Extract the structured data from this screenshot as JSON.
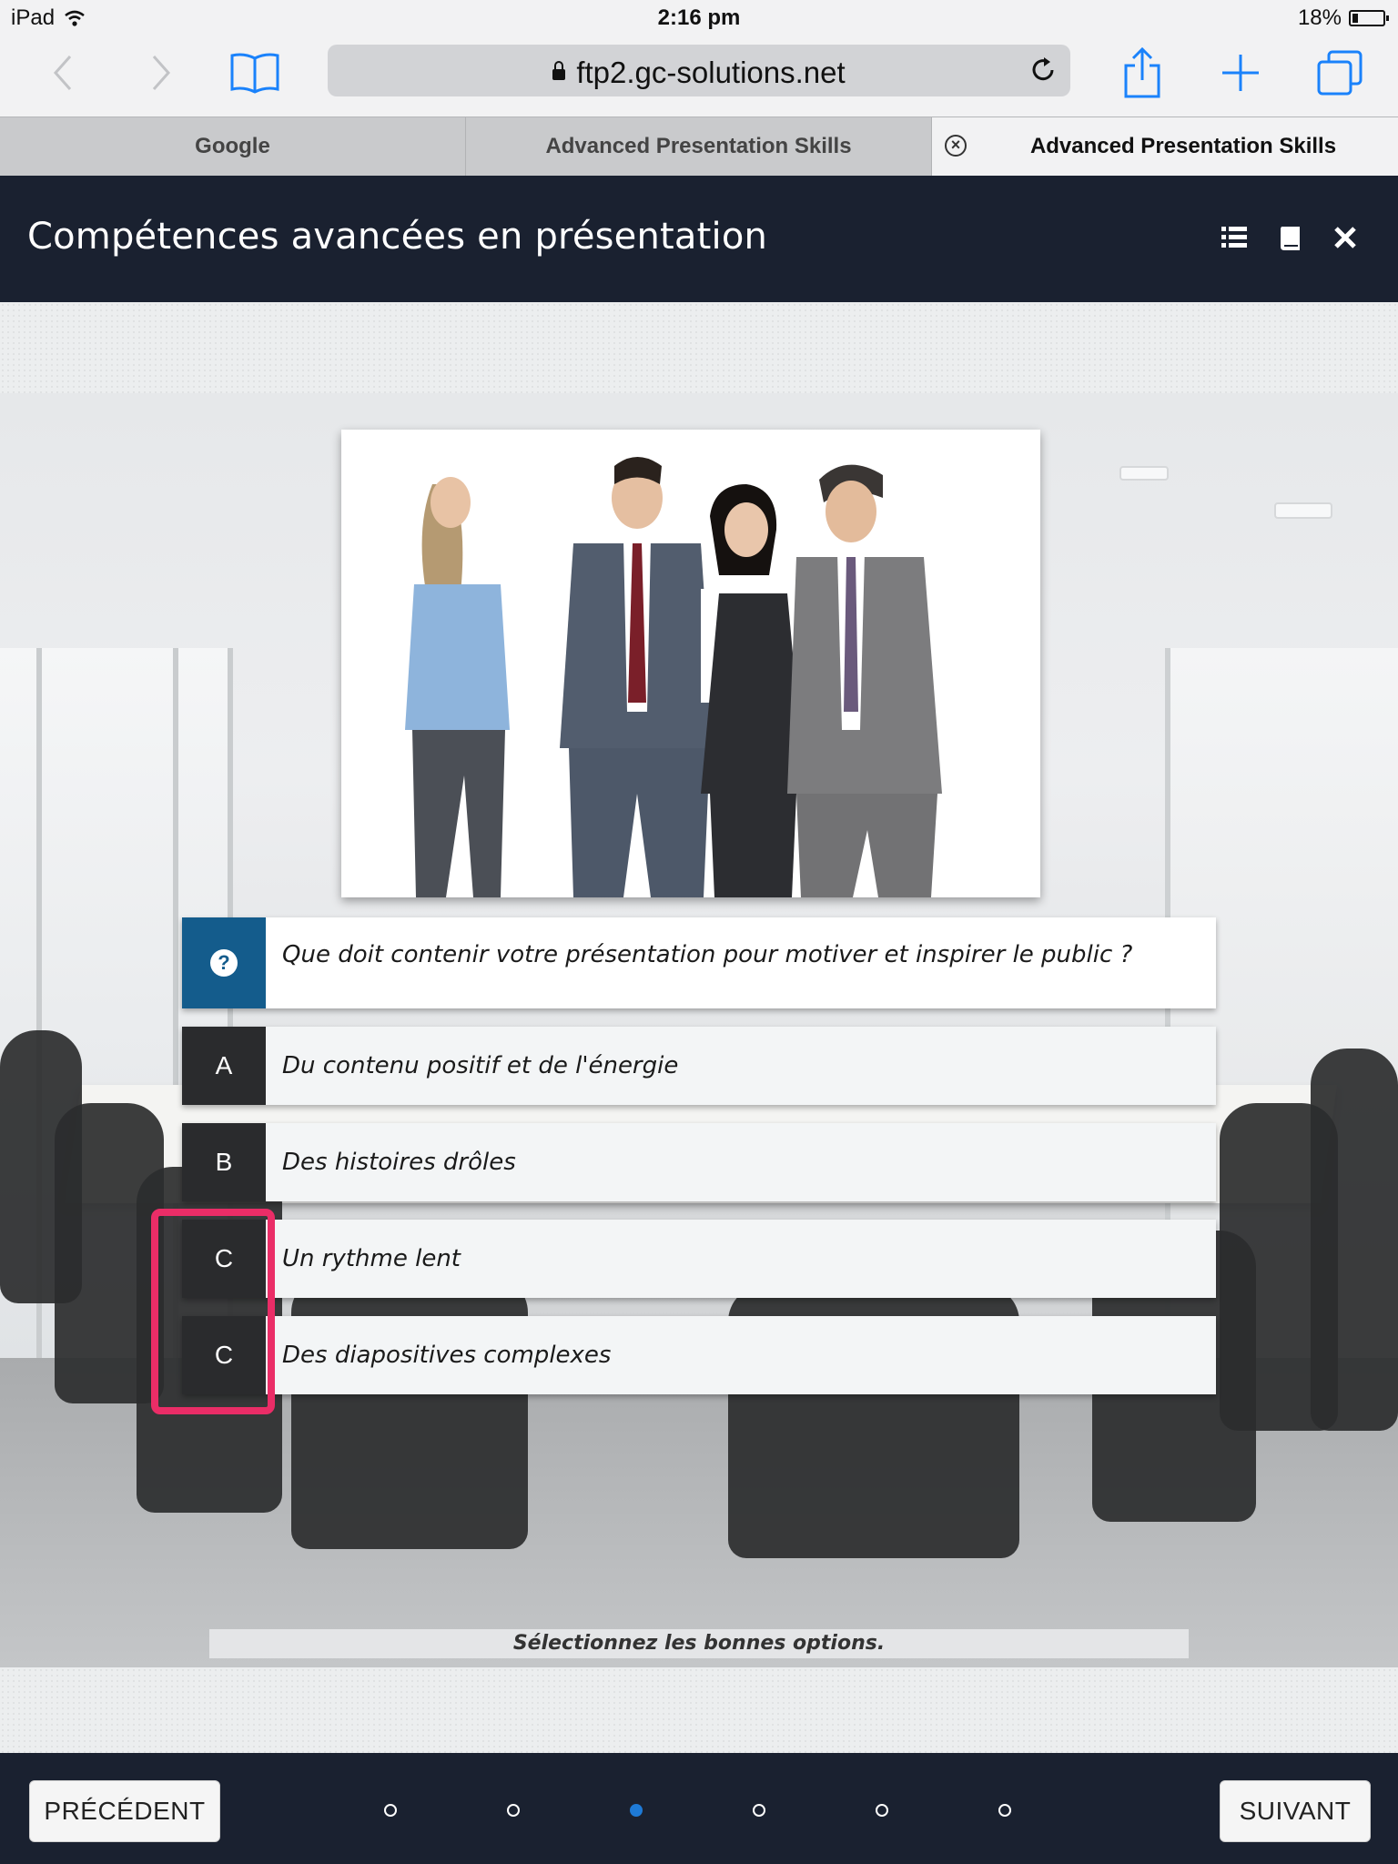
{
  "status_bar": {
    "device": "iPad",
    "time": "2:16 pm",
    "battery": "18%",
    "battery_level": 0.18
  },
  "browser": {
    "url": "ftp2.gc-solutions.net",
    "tabs": [
      {
        "label": "Google",
        "active": false
      },
      {
        "label": "Advanced Presentation Skills",
        "active": false
      },
      {
        "label": "Advanced Presentation Skills",
        "active": true
      }
    ]
  },
  "app": {
    "title": "Compétences avancées en présentation",
    "header_icons": [
      "list-icon",
      "book-icon",
      "close-icon"
    ]
  },
  "quiz": {
    "question": "Que doit contenir votre présentation pour motiver et inspirer le public ?",
    "question_icon": "?",
    "options": [
      {
        "letter": "A",
        "text": "Du contenu positif et de l'énergie"
      },
      {
        "letter": "B",
        "text": "Des histoires drôles"
      },
      {
        "letter": "C",
        "text": "Un rythme lent"
      },
      {
        "letter": "C",
        "text": "Des diapositives complexes"
      }
    ],
    "instruction": "Sélectionnez les bonnes options."
  },
  "footer": {
    "prev_label": "PRÉCÉDENT",
    "next_label": "SUIVANT",
    "page_count": 6,
    "active_page": 3
  },
  "colors": {
    "header_bg": "#1a2130",
    "question_label": "#145c8c",
    "option_label": "#2a2b2d",
    "highlight": "#ea2d67",
    "active_dot": "#1e7ad6",
    "ios_blue": "#1a82fb"
  }
}
